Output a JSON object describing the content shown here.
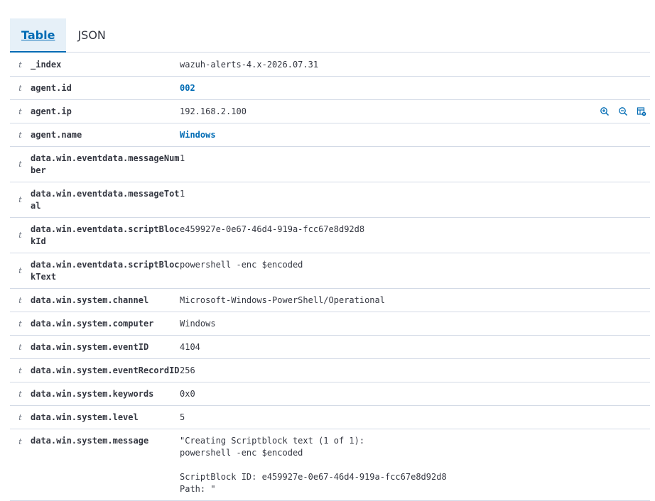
{
  "tabs": [
    {
      "label": "Table",
      "selected": true
    },
    {
      "label": "JSON",
      "selected": false
    }
  ],
  "rows": [
    {
      "type": "t",
      "field": "_index",
      "value": "wazuh-alerts-4.x-2026.07.31"
    },
    {
      "type": "t",
      "field": "agent.id",
      "value": "002",
      "link": true
    },
    {
      "type": "t",
      "field": "agent.ip",
      "value": "192.168.2.100"
    },
    {
      "type": "t",
      "field": "agent.name",
      "value": "Windows",
      "link": true
    },
    {
      "type": "t",
      "field": "data.win.eventdata.messageNumber",
      "value": "1"
    },
    {
      "type": "t",
      "field": "data.win.eventdata.messageTotal",
      "value": "1"
    },
    {
      "type": "t",
      "field": "data.win.eventdata.scriptBlockId",
      "value": "e459927e-0e67-46d4-919a-fcc67e8d92d8"
    },
    {
      "type": "t",
      "field": "data.win.eventdata.scriptBlockText",
      "value": "powershell -enc $encoded"
    },
    {
      "type": "t",
      "field": "data.win.system.channel",
      "value": "Microsoft-Windows-PowerShell/Operational"
    },
    {
      "type": "t",
      "field": "data.win.system.computer",
      "value": "Windows"
    },
    {
      "type": "t",
      "field": "data.win.system.eventID",
      "value": "4104"
    },
    {
      "type": "t",
      "field": "data.win.system.eventRecordID",
      "value": "256"
    },
    {
      "type": "t",
      "field": "data.win.system.keywords",
      "value": "0x0"
    },
    {
      "type": "t",
      "field": "data.win.system.level",
      "value": "5"
    },
    {
      "type": "t",
      "field": "data.win.system.message",
      "value": "\"Creating Scriptblock text (1 of 1):\npowershell -enc $encoded\n\nScriptBlock ID: e459927e-0e67-46d4-919a-fcc67e8d92d8\nPath: \""
    }
  ],
  "row_actions": {
    "zoom_in": "magnify-plus-icon",
    "zoom_out": "magnify-minus-icon",
    "toggle_column": "table-column-icon",
    "color": "#006bb4"
  }
}
